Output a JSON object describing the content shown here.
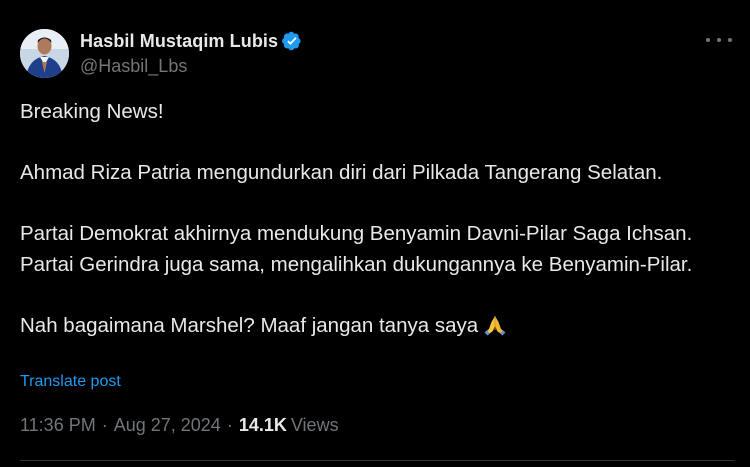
{
  "author": {
    "display_name": "Hasbil Mustaqim Lubis",
    "handle": "@Hasbil_Lbs",
    "verified": true
  },
  "tweet": {
    "paragraphs": [
      "Breaking News!",
      "Ahmad Riza Patria mengundurkan diri dari Pilkada Tangerang Selatan.",
      "Partai Demokrat akhirnya mendukung Benyamin Davni-Pilar Saga Ichsan. Partai Gerindra juga sama, mengalihkan dukungannya ke Benyamin-Pilar.",
      "Nah bagaimana Marshel? Maaf jangan tanya saya"
    ],
    "emoji": "folded-hands"
  },
  "translate_label": "Translate post",
  "meta": {
    "time": "11:36 PM",
    "separator": "·",
    "date": "Aug 27, 2024",
    "views_count": "14.1K",
    "views_label": "Views"
  },
  "colors": {
    "background": "#000000",
    "text": "#e7e9ea",
    "muted": "#71767b",
    "link": "#1d9bf0",
    "verified": "#1d9bf0"
  }
}
